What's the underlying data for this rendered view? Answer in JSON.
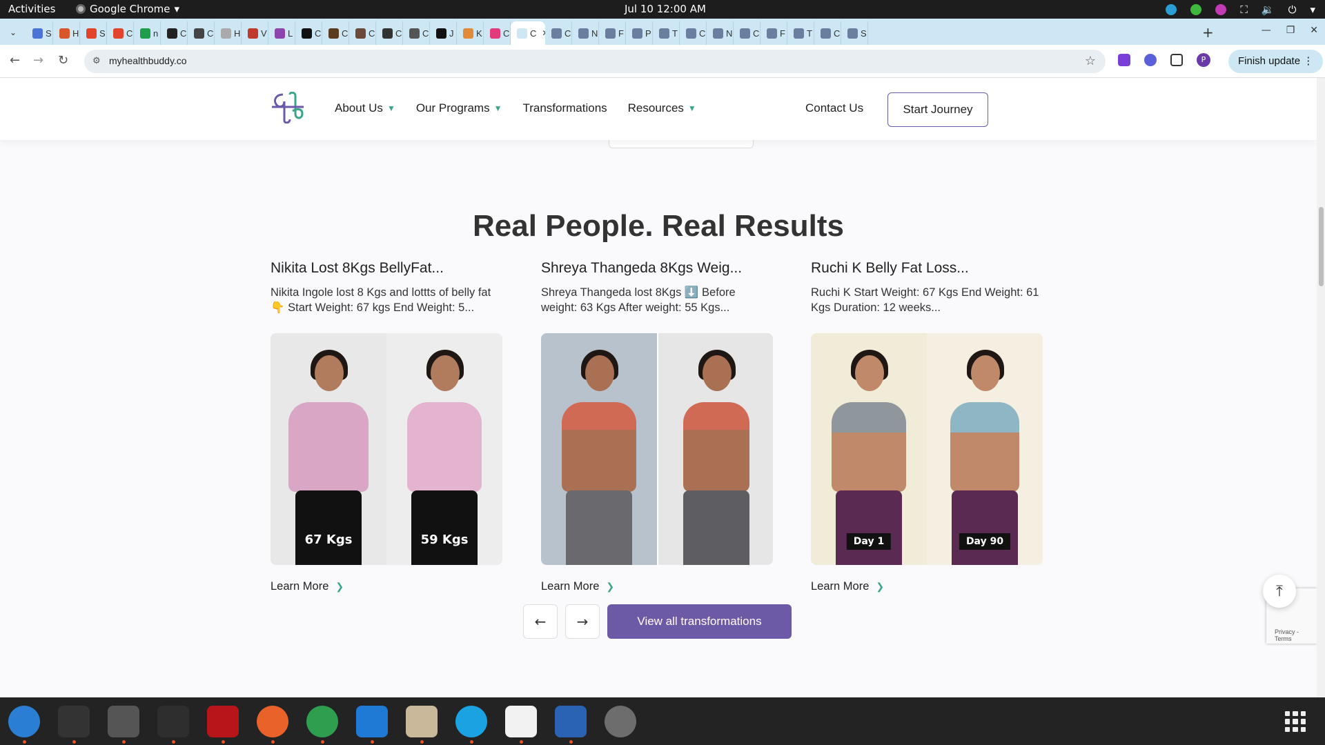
{
  "system": {
    "activities": "Activities",
    "app_name": "Google Chrome",
    "clock": "Jul 10  12:00 AM"
  },
  "browser": {
    "tabs": [
      {
        "letter": "S",
        "color": "#4a74d8"
      },
      {
        "letter": "H",
        "color": "#d8562a"
      },
      {
        "letter": "S",
        "color": "#e2432a"
      },
      {
        "letter": "C",
        "color": "#e2432a"
      },
      {
        "letter": "n",
        "color": "#1e9e4a"
      },
      {
        "letter": "C",
        "color": "#222222"
      },
      {
        "letter": "C",
        "color": "#444444"
      },
      {
        "letter": "H",
        "color": "#aaaaaa"
      },
      {
        "letter": "V",
        "color": "#c0392b"
      },
      {
        "letter": "L",
        "color": "#8e44ad"
      },
      {
        "letter": "C",
        "color": "#111111"
      },
      {
        "letter": "C",
        "color": "#5a3d1e"
      },
      {
        "letter": "C",
        "color": "#6b4a3a"
      },
      {
        "letter": "C",
        "color": "#333333"
      },
      {
        "letter": "C",
        "color": "#555555"
      },
      {
        "letter": "J",
        "color": "#111111"
      },
      {
        "letter": "K",
        "color": "#e08a3a"
      },
      {
        "letter": "C",
        "color": "#e23a7a"
      },
      {
        "letter": "C",
        "color": "#ffffff",
        "active": true
      },
      {
        "letter": "C",
        "color": "#6a7fa0"
      },
      {
        "letter": "N",
        "color": "#6a7fa0"
      },
      {
        "letter": "F",
        "color": "#6a7fa0"
      },
      {
        "letter": "P",
        "color": "#6a7fa0"
      },
      {
        "letter": "T",
        "color": "#6a7fa0"
      },
      {
        "letter": "C",
        "color": "#6a7fa0"
      },
      {
        "letter": "N",
        "color": "#6a7fa0"
      },
      {
        "letter": "C",
        "color": "#6a7fa0"
      },
      {
        "letter": "F",
        "color": "#6a7fa0"
      },
      {
        "letter": "T",
        "color": "#6a7fa0"
      },
      {
        "letter": "C",
        "color": "#6a7fa0"
      },
      {
        "letter": "S",
        "color": "#6a7fa0"
      }
    ],
    "url": "myhealthbuddy.co",
    "profile_letter": "P",
    "finish_update": "Finish update"
  },
  "site": {
    "nav": {
      "about": "About Us",
      "programs": "Our Programs",
      "transformations": "Transformations",
      "resources": "Resources",
      "contact": "Contact Us",
      "start": "Start Journey"
    },
    "section_title": "Real People. Real Results",
    "cards": [
      {
        "title": "Nikita Lost 8Kgs BellyFat...",
        "desc": "Nikita Ingole lost 8 Kgs and lottts of belly fat 👇 Start Weight: 67 kgs End Weight: 5...",
        "tag_before": "67 Kgs",
        "tag_after": "59 Kgs",
        "learn": "Learn More"
      },
      {
        "title": "Shreya Thangeda 8Kgs Weig...",
        "desc": "Shreya Thangeda lost 8Kgs ⬇️ Before weight: 63 Kgs After weight: 55 Kgs...",
        "tag_before": "",
        "tag_after": "",
        "learn": "Learn More"
      },
      {
        "title": "Ruchi K Belly Fat Loss...",
        "desc": "Ruchi K Start Weight: 67 Kgs End Weight: 61 Kgs Duration: 12 weeks...",
        "tag_before": "Day 1",
        "tag_after": "Day 90",
        "learn": "Learn More"
      }
    ],
    "view_all": "View all transformations",
    "recaptcha": "Privacy - Terms"
  },
  "colors": {
    "brand_purple": "#6c5aa6",
    "accent_green": "#3aa58a"
  }
}
